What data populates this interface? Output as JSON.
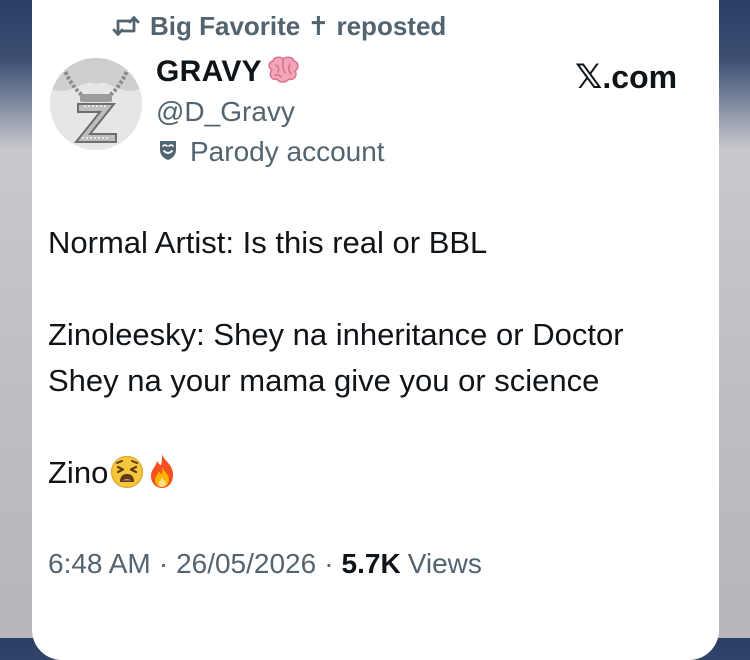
{
  "repost_header": {
    "icon": "repost-icon",
    "text": "Big Favorite ✝ reposted"
  },
  "author": {
    "display_name": "GRAVY",
    "name_emoji": "brain-icon",
    "handle": "@D_Gravy",
    "label_icon": "parody-mask-icon",
    "label": "Parody account"
  },
  "source": {
    "logo": "𝕏",
    "domain": ".com"
  },
  "tweet": {
    "line1": "Normal Artist: Is this real or BBL",
    "line2": "Zinoleesky: Shey na inheritance or Doctor",
    "line3": "Shey na your mama give you or science",
    "line4": "Zino",
    "emojis": [
      "weary-face-icon",
      "fire-icon"
    ]
  },
  "meta": {
    "time": "6:48 AM",
    "separator": "·",
    "date": "26/05/2026",
    "views_count": "5.7K",
    "views_label": "Views"
  },
  "colors": {
    "primary_text": "#0f1419",
    "secondary_text": "#536471",
    "card_bg": "#ffffff"
  }
}
